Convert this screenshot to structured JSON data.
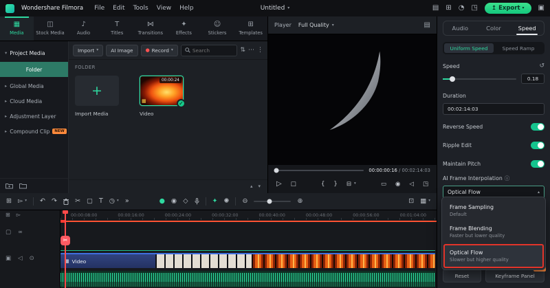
{
  "colors": {
    "accent": "#2fd9a0",
    "annotation_red": "#e2342a",
    "playhead_red": "#ff4a4a",
    "badge_orange": "#ff8a3c"
  },
  "menubar": {
    "brand": "Wondershare Filmora",
    "menus": [
      "File",
      "Edit",
      "Tools",
      "View",
      "Help"
    ],
    "title": "Untitled",
    "export_label": "Export"
  },
  "library_tabs": [
    {
      "label": "Media"
    },
    {
      "label": "Stock Media"
    },
    {
      "label": "Audio"
    },
    {
      "label": "Titles"
    },
    {
      "label": "Transitions"
    },
    {
      "label": "Effects"
    },
    {
      "label": "Stickers"
    },
    {
      "label": "Templates"
    }
  ],
  "sidebar": {
    "items": [
      {
        "label": "Project Media"
      },
      {
        "label": "Folder"
      },
      {
        "label": "Global Media"
      },
      {
        "label": "Cloud Media"
      },
      {
        "label": "Adjustment Layer"
      },
      {
        "label": "Compound Clip",
        "badge": "NEW"
      }
    ]
  },
  "media_panel": {
    "import_label": "Import",
    "ai_image_label": "AI Image",
    "record_label": "Record",
    "search_placeholder": "Search",
    "section_label": "FOLDER",
    "import_tile_label": "Import Media",
    "video_tile_label": "Video",
    "video_duration": "00:00:24"
  },
  "preview": {
    "player_label": "Player",
    "quality_value": "Full Quality",
    "current_time": "00:00:00:16",
    "separator": "/",
    "total_time": "00:02:14:03"
  },
  "properties": {
    "tabs": [
      "Audio",
      "Color",
      "Speed"
    ],
    "mode_tabs": [
      "Uniform Speed",
      "Speed Ramp"
    ],
    "speed_label": "Speed",
    "speed_value": "0.18",
    "duration_label": "Duration",
    "duration_value": "00:02:14:03",
    "toggles": [
      {
        "label": "Reverse Speed",
        "on": true
      },
      {
        "label": "Ripple Edit",
        "on": true
      },
      {
        "label": "Maintain Pitch",
        "on": true
      }
    ],
    "interpolation_label": "AI Frame Interpolation",
    "interpolation_value": "Optical Flow",
    "options": [
      {
        "label": "Frame Sampling",
        "desc": "Default"
      },
      {
        "label": "Frame Blending",
        "desc": "Faster but lower quality"
      },
      {
        "label": "Optical Flow",
        "desc": "Slower but higher quality"
      }
    ],
    "reset_label": "Reset",
    "keyframe_label": "Keyframe Panel",
    "keyframe_badge": "NEW"
  },
  "timeline": {
    "ruler": [
      "00:00:08:00",
      "00:00:16:00",
      "00:00:24:00",
      "00:00:32:00",
      "00:00:40:00",
      "00:00:48:00",
      "00:00:56:00",
      "00:01:04:00"
    ],
    "video_label": "Video"
  },
  "icons": {
    "chevron_down": "▾",
    "chevron_up": "▴",
    "chevron_right": "▸",
    "plus": "+",
    "check": "✓",
    "more_h": "⋯",
    "kebab": "⋮",
    "sort": "⇅",
    "undo": "↶",
    "redo": "↷",
    "scissors": "✂",
    "text_tool": "T",
    "crop": "▢",
    "timer": "◷",
    "more_tools": "»",
    "record_dot": "●",
    "zoom_in": "⊕",
    "zoom_out": "⊖",
    "fit": "⊡",
    "play": "▷",
    "stop": "□",
    "bracket_l": "{",
    "bracket_r": "}",
    "split": "⊟",
    "screen": "▭",
    "snapshot": "◉",
    "volume": "◁",
    "fullscreen": "◳",
    "info": "ⓘ",
    "reset": "↺",
    "tab_media": "▦",
    "tab_stock": "◫",
    "tab_audio": "♪",
    "tab_titles": "T",
    "tab_transitions": "⋈",
    "tab_effects": "✦",
    "tab_stickers": "☺",
    "tab_templates": "⊞",
    "workspace": "▤",
    "apps": "⊞",
    "bell": "◔",
    "focus": "◳",
    "upload": "↥",
    "panels": "▣",
    "pointer": "▻",
    "grid": "⊞",
    "mask": "◇",
    "motion": "◉",
    "ai_star": "✦",
    "sparkle": "✺",
    "list_view": "▦",
    "film": "▦",
    "lock": "▣",
    "eye": "⊙",
    "box": "▢",
    "link": "∞",
    "compare": "▤"
  }
}
